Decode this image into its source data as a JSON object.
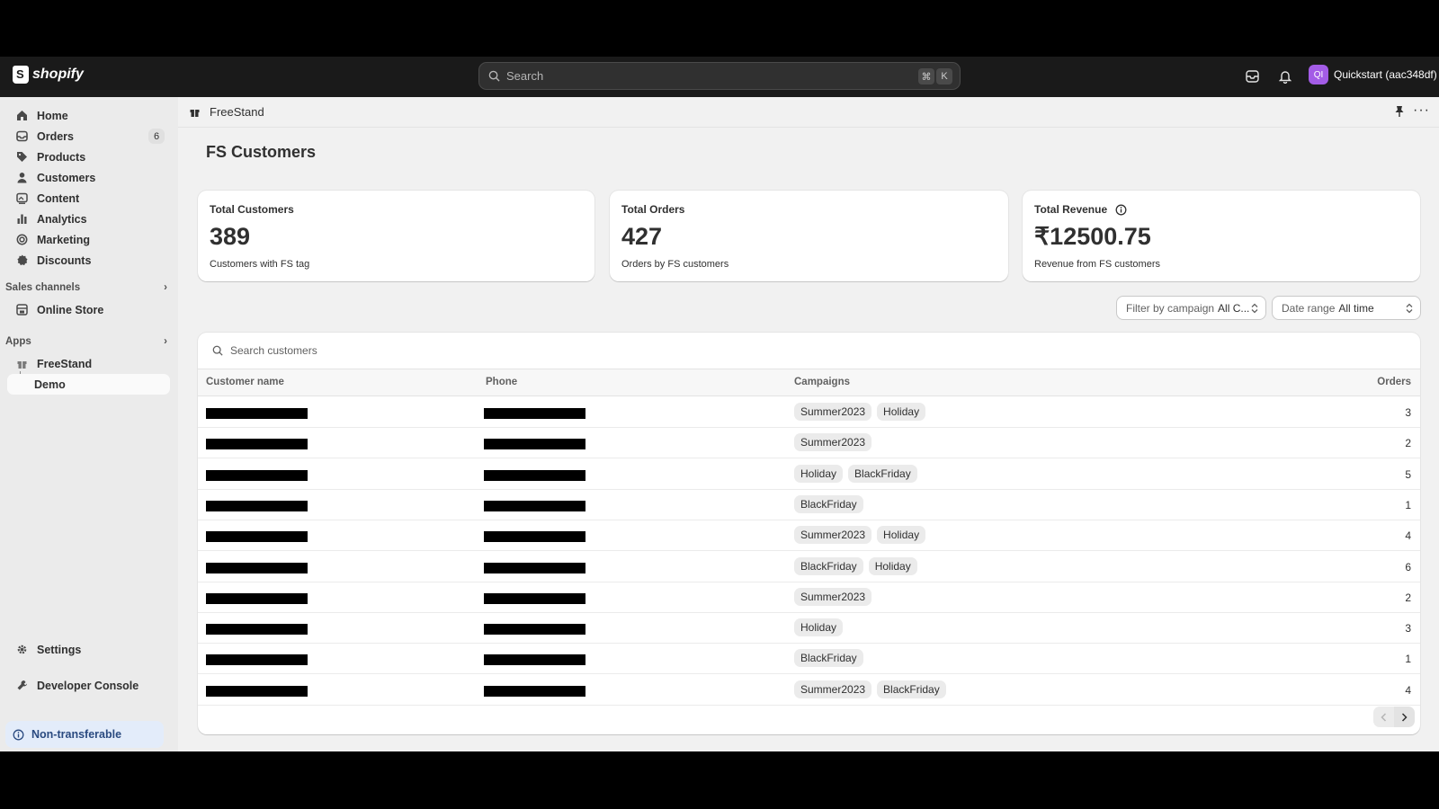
{
  "topbar": {
    "brand": "shopify",
    "search_placeholder": "Search",
    "shortcut_cmd": "⌘",
    "shortcut_key": "K",
    "store_initials": "QI",
    "store_name": "Quickstart (aac348df)"
  },
  "sidebar": {
    "items": [
      {
        "label": "Home",
        "icon": "home-icon"
      },
      {
        "label": "Orders",
        "icon": "orders-icon",
        "badge": "6"
      },
      {
        "label": "Products",
        "icon": "tag-icon"
      },
      {
        "label": "Customers",
        "icon": "person-icon"
      },
      {
        "label": "Content",
        "icon": "content-icon"
      },
      {
        "label": "Analytics",
        "icon": "bar-chart-icon"
      },
      {
        "label": "Marketing",
        "icon": "target-icon"
      },
      {
        "label": "Discounts",
        "icon": "discount-icon"
      }
    ],
    "sales_channels_label": "Sales channels",
    "online_store_label": "Online Store",
    "apps_label": "Apps",
    "freestand_label": "FreeStand",
    "demo_label": "Demo",
    "settings_label": "Settings",
    "dev_console_label": "Developer Console",
    "non_transferable_label": "Non-transferable"
  },
  "appbar": {
    "title": "FreeStand"
  },
  "page": {
    "title": "FS Customers"
  },
  "stats": [
    {
      "label": "Total Customers",
      "value": "389",
      "sub": "Customers with FS tag"
    },
    {
      "label": "Total Orders",
      "value": "427",
      "sub": "Orders by FS customers"
    },
    {
      "label": "Total Revenue",
      "value": "₹12500.75",
      "sub": "Revenue from FS customers"
    }
  ],
  "filters": {
    "campaign_label": "Filter by campaign",
    "campaign_value": "All C...",
    "date_label": "Date range",
    "date_value": "All time"
  },
  "table": {
    "search_placeholder": "Search customers",
    "headers": {
      "name": "Customer name",
      "phone": "Phone",
      "campaigns": "Campaigns",
      "orders": "Orders"
    },
    "rows": [
      {
        "campaigns": [
          "Summer2023",
          "Holiday"
        ],
        "orders": "3"
      },
      {
        "campaigns": [
          "Summer2023"
        ],
        "orders": "2"
      },
      {
        "campaigns": [
          "Holiday",
          "BlackFriday"
        ],
        "orders": "5"
      },
      {
        "campaigns": [
          "BlackFriday"
        ],
        "orders": "1"
      },
      {
        "campaigns": [
          "Summer2023",
          "Holiday"
        ],
        "orders": "4"
      },
      {
        "campaigns": [
          "BlackFriday",
          "Holiday"
        ],
        "orders": "6"
      },
      {
        "campaigns": [
          "Summer2023"
        ],
        "orders": "2"
      },
      {
        "campaigns": [
          "Holiday"
        ],
        "orders": "3"
      },
      {
        "campaigns": [
          "BlackFriday"
        ],
        "orders": "1"
      },
      {
        "campaigns": [
          "Summer2023",
          "BlackFriday"
        ],
        "orders": "4"
      }
    ]
  }
}
